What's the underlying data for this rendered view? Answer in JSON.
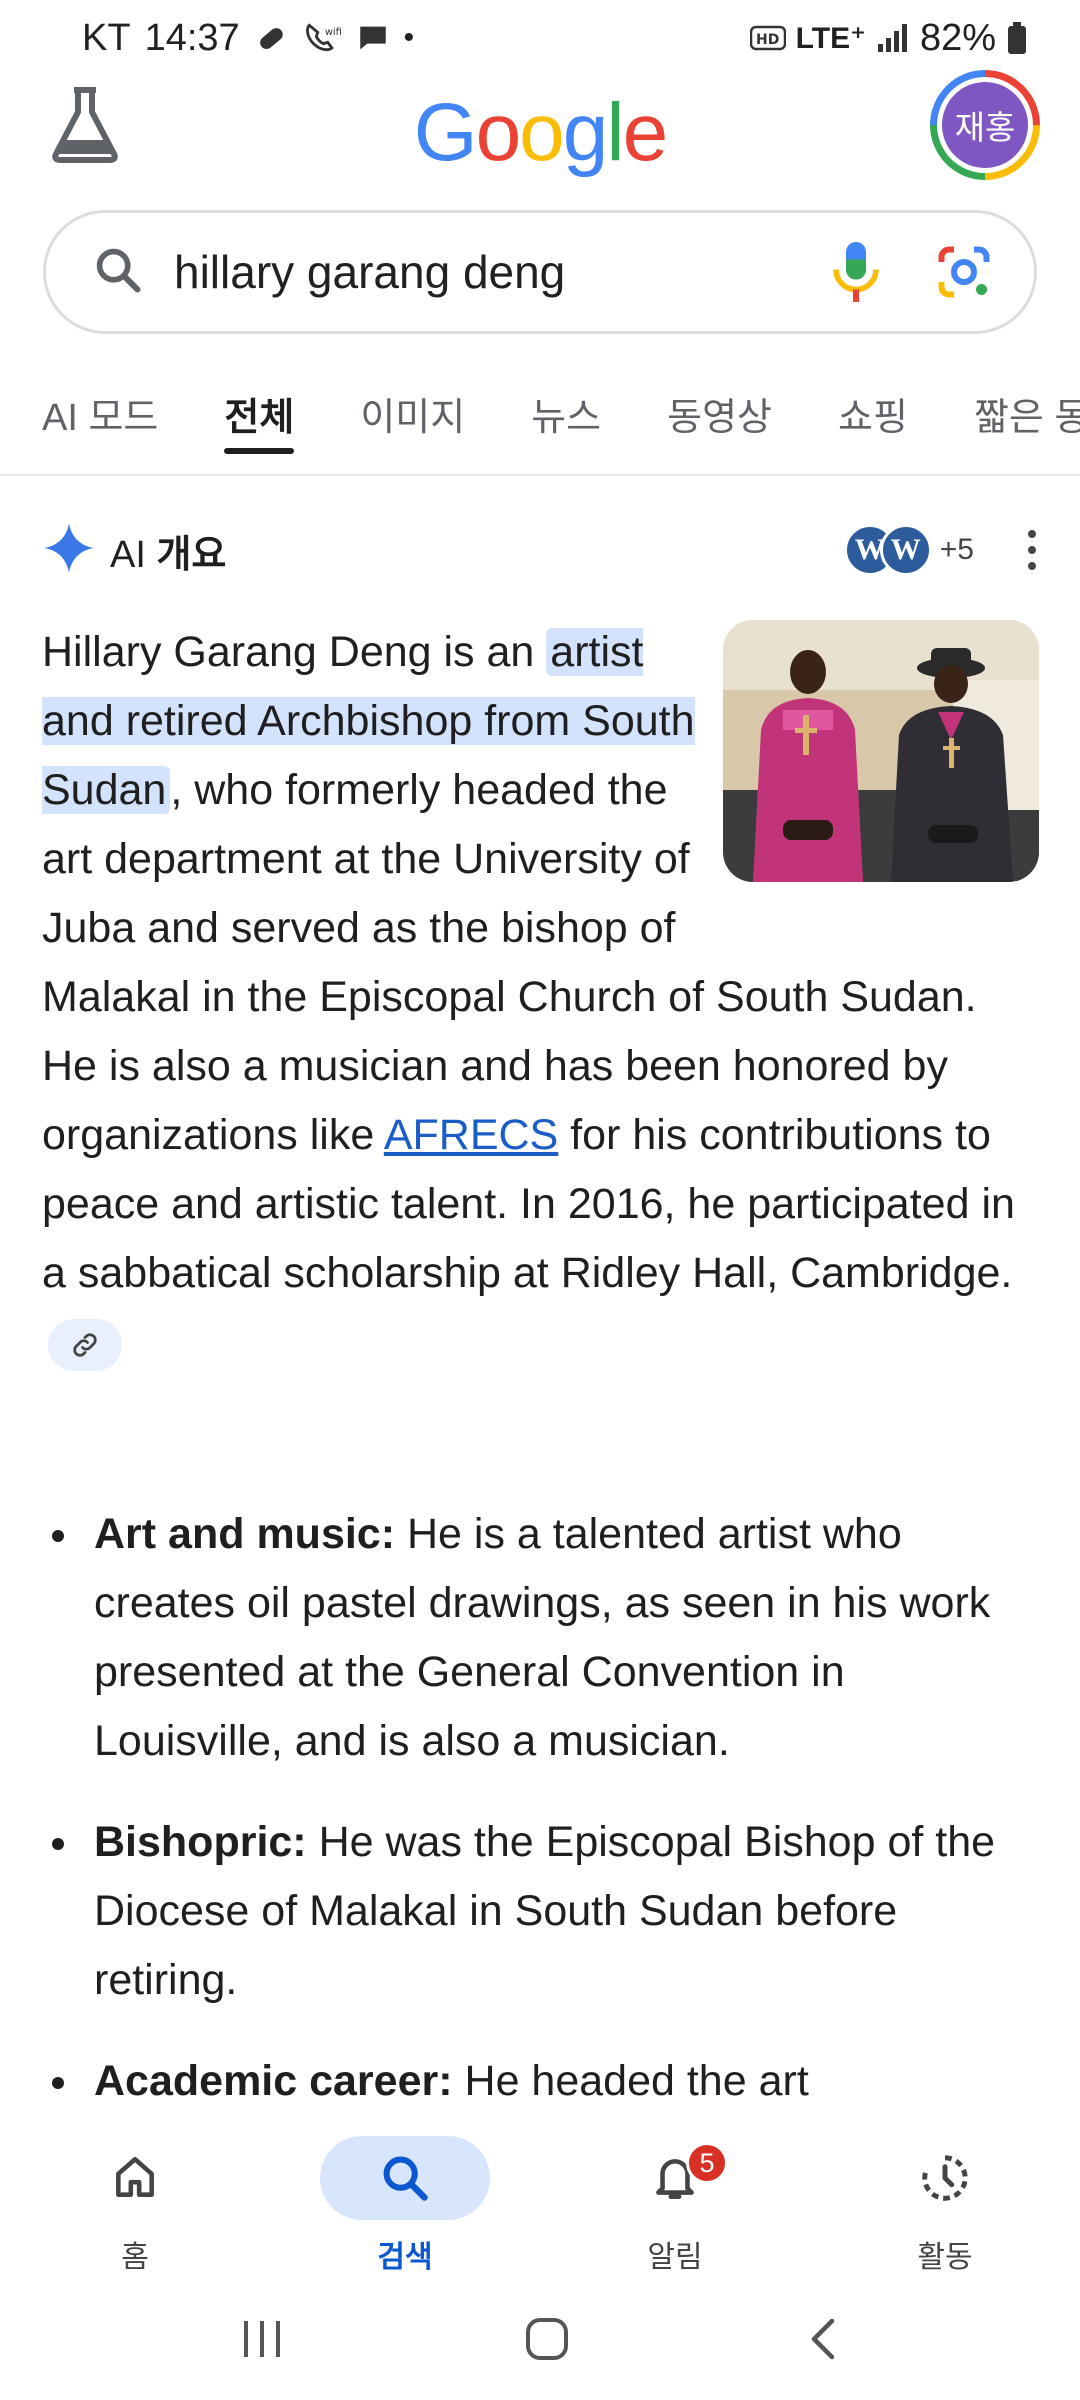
{
  "status_bar": {
    "carrier": "KT",
    "time": "14:37",
    "dot": "•",
    "network": "LTE⁺",
    "battery": "82%"
  },
  "header": {
    "logo_text": "Google",
    "avatar_text": "재홍"
  },
  "search": {
    "query": "hillary garang deng"
  },
  "tabs": [
    {
      "label": "AI 모드",
      "active": false
    },
    {
      "label": "전체",
      "active": true
    },
    {
      "label": "이미지",
      "active": false
    },
    {
      "label": "뉴스",
      "active": false
    },
    {
      "label": "동영상",
      "active": false
    },
    {
      "label": "쇼핑",
      "active": false
    },
    {
      "label": "짧은 동",
      "active": false
    }
  ],
  "ai_overview": {
    "title_prefix": "AI",
    "title_bold": "개요",
    "sources_more": "+5",
    "source_icon_letter": "W",
    "summary": {
      "part1": "Hillary Garang Deng is an ",
      "highlight": "artist and retired Archbishop from South Sudan",
      "part2": ", who formerly headed the art department at the University of Juba and served as the bishop of Malakal in the Episcopal Church of South Sudan. He is also a musician and has been honored by organizations like ",
      "link": "AFRECS",
      "part3": " for his contributions to peace and artistic talent. In 2016, he participated in a sabbatical scholarship at Ridley Hall, Cambridge."
    },
    "bullets": [
      {
        "label": "Art and music:",
        "text": " He is a talented artist who creates oil pastel drawings, as seen in his work presented at the General Convention in Louisville, and is also a musician."
      },
      {
        "label": "Bishopric:",
        "text": " He was the Episcopal Bishop of the Diocese of Malakal in South Sudan before retiring."
      },
      {
        "label": "Academic career:",
        "text": " He headed the art"
      }
    ]
  },
  "bottom_nav": {
    "items": [
      {
        "label": "홈",
        "icon": "home-icon",
        "active": false
      },
      {
        "label": "검색",
        "icon": "search-icon",
        "active": true
      },
      {
        "label": "알림",
        "icon": "bell-icon",
        "active": false,
        "badge": "5"
      },
      {
        "label": "활동",
        "icon": "activity-icon",
        "active": false
      }
    ]
  },
  "colors": {
    "accent": "#0b57d0",
    "highlight": "#d3e3fd",
    "avatar_bg": "#7e57c2",
    "link": "#1a5dc7"
  }
}
